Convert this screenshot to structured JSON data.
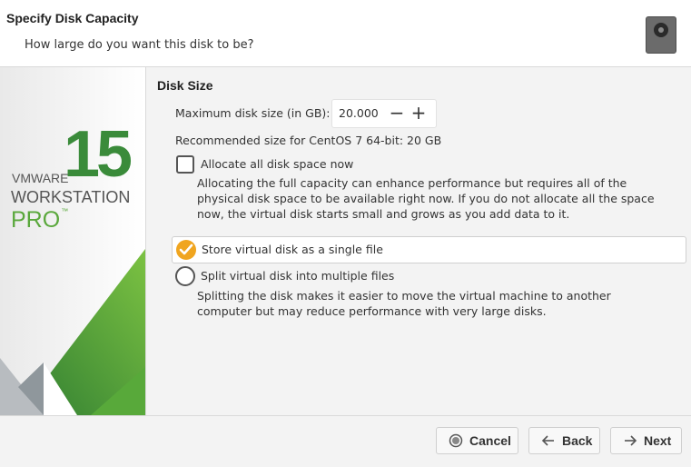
{
  "header": {
    "title": "Specify Disk Capacity",
    "subtitle": "How large do you want this disk to be?",
    "icon": "hard-disk-icon"
  },
  "banner": {
    "number": "15",
    "vmware": "VMWARE",
    "workstation": "WORKSTATION",
    "pro": "PRO",
    "tm": "™"
  },
  "disk_size": {
    "section_title": "Disk Size",
    "max_label": "Maximum disk size (in GB):",
    "max_value": "20.000",
    "recommended": "Recommended size for CentOS 7 64-bit: 20 GB"
  },
  "allocate": {
    "label": "Allocate all disk space now",
    "checked": false,
    "description": "Allocating the full capacity can enhance performance but requires all of the physical disk space to be available right now. If you do not allocate all the space now, the virtual disk starts small and grows as you add data to it."
  },
  "storage_options": {
    "single": {
      "label": "Store virtual disk as a single file",
      "selected": true
    },
    "split": {
      "label": "Split virtual disk into multiple files",
      "selected": false,
      "description": "Splitting the disk makes it easier to move the virtual machine to another computer but may reduce performance with very large disks."
    }
  },
  "footer": {
    "cancel": "Cancel",
    "back": "Back",
    "next": "Next"
  },
  "colors": {
    "accent": "#f0a51f",
    "brand_green": "#3a8b3a",
    "panel_bg": "#f3f3f3"
  }
}
